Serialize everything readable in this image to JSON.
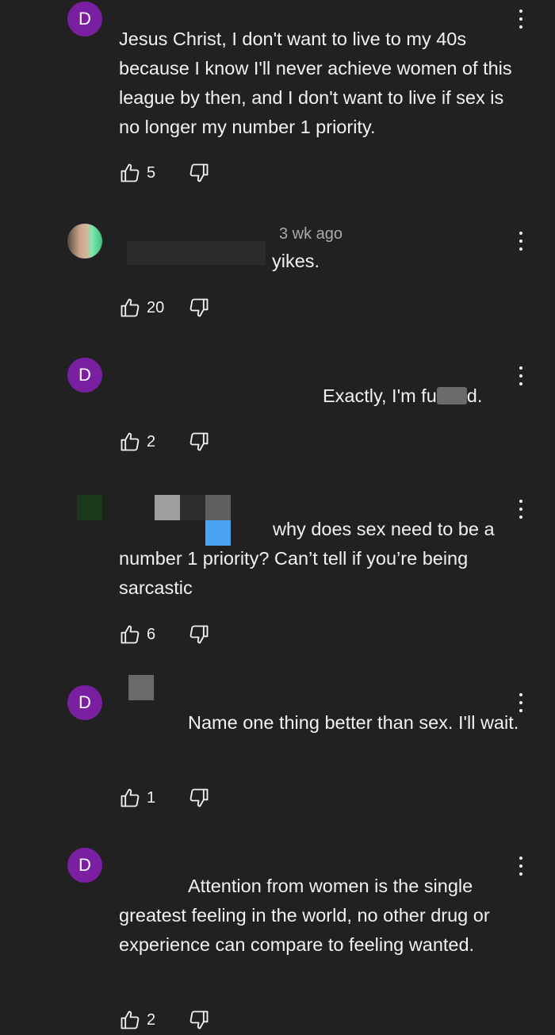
{
  "comments": [
    {
      "avatar_letter": "D",
      "timestamp": "",
      "text": "Jesus Christ, I don't want to live to my 40s because I know I'll never achieve women of this league by then, and I don't want to live if sex is no longer my number 1 priority.",
      "likes": "5"
    },
    {
      "avatar_letter": "",
      "timestamp": "3 wk ago",
      "text": "yikes.",
      "likes": "20"
    },
    {
      "avatar_letter": "D",
      "timestamp": "",
      "text_before": "Exactly, I'm fu",
      "text_after": "d.",
      "likes": "2"
    },
    {
      "avatar_letter": "",
      "timestamp": "",
      "text": "why does sex need to be a number 1 priority? Can’t tell if you’re being sarcastic",
      "likes": "6"
    },
    {
      "avatar_letter": "D",
      "timestamp": "",
      "text": "Name one thing better than sex. I'll wait.",
      "likes": "1"
    },
    {
      "avatar_letter": "D",
      "timestamp": "",
      "text": "Attention from women is the single greatest feeling in the world, no other drug or experience can compare to feeling wanted.",
      "likes": "2"
    }
  ],
  "colors": {
    "background": "#212121",
    "text": "#f1f1f1",
    "meta": "#aaaaaa",
    "avatar": "#7b1fa2"
  }
}
